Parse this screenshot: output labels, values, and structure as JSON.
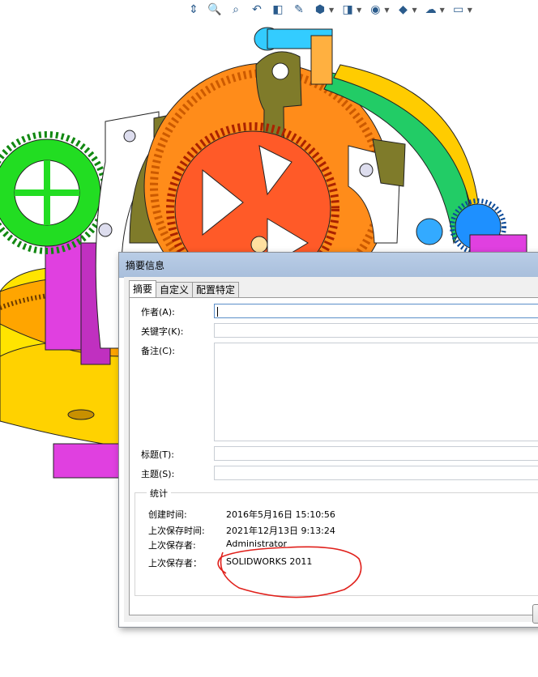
{
  "toolbar": {
    "icons": [
      "view-orientation-icon",
      "zoom-to-area-icon",
      "zoom-fit-icon",
      "previous-view-icon",
      "section-view-icon",
      "dynamic-annotation-icon",
      "view-cube-icon",
      "display-style-icon",
      "hide-show-icon",
      "appearance-icon",
      "scene-icon",
      "monitor-icon"
    ]
  },
  "dialog": {
    "title": "摘要信息",
    "tabs": [
      "摘要",
      "自定义",
      "配置特定"
    ],
    "fields": {
      "author_label": "作者(A):",
      "keywords_label": "关键字(K):",
      "comments_label": "备注(C):",
      "title_label": "标题(T):",
      "subject_label": "主题(S):"
    },
    "stats": {
      "legend": "统计",
      "created_label": "创建时间:",
      "created_value": "2016年5月16日 15:10:56",
      "last_saved_label": "上次保存时间:",
      "last_saved_value": "2021年12月13日 9:13:24",
      "saved_by_label": "上次保存者:",
      "saved_by_value": "Administrator",
      "saved_with_label": "上次保存者：",
      "saved_with_value": "SOLIDWORKS 2011"
    }
  },
  "colors": {
    "annotation_red": "#e0201b",
    "gear_orange": "#ff7a2e",
    "gear_green": "#22dd22",
    "gear_magenta": "#e040e0",
    "olive_bracket": "#7f7b2a",
    "yellow_base": "#ffe400"
  }
}
